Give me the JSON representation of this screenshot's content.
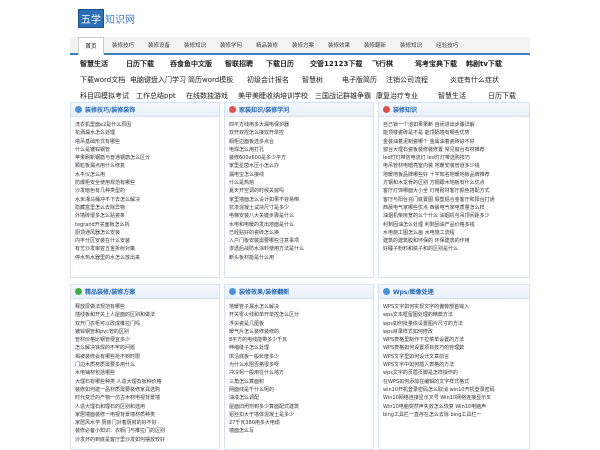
{
  "logo": {
    "box": "五学",
    "rest": "知识网"
  },
  "nav": [
    "首页",
    "装修技巧",
    "装修设备",
    "装修知识",
    "装修学问",
    "精品装修",
    "装修方案",
    "装修效果",
    "装修翻新",
    "装修知识",
    "经验技巧"
  ],
  "links": [
    [
      "智慧生活",
      "日历下载",
      "吞食鱼中文版",
      "智联招聘",
      "下载日历",
      "交管12123下载",
      "飞行棋",
      "驾考宝典下载",
      "韩剧tv下载"
    ],
    [
      "下载word文档",
      "电脑键盘入门学习",
      "简历word模板",
      "初级会计报名",
      "智慧树",
      "电子版简历",
      "注销公司流程",
      "炎症有什么症状"
    ],
    [
      "科目四模拟考试",
      "工作总结ppt",
      "在线数独游戏",
      "美甲美睫收纳培训学校",
      "三国战记群雄争霸",
      "康复治疗专业",
      "智慧生活",
      "日历下载"
    ]
  ],
  "panels": [
    {
      "title": "装修技巧/装修装饰",
      "icon_color": "#4a90d9",
      "items": [
        "洗衣机里面e2是什么原因",
        "花洒漏水怎么处理",
        "塔吊基础形式有哪些",
        "什么是镀锌钢管",
        "苹果刷新钢筋与普通钢筋怎么区分",
        "颗粒板漏点用什么修复",
        "水平仪怎么用",
        "防爆柜安全使用规范有哪些",
        "沙发暗色有几种类型的",
        "水米湘马桶冲不下去怎么解决",
        "隐藏盒里怎么去除异物",
        "外墙砖很多怎么贴瓷条",
        "tegrand开关面板怎么拆",
        "厨顶通风器怎么安装",
        "内丰分区安装在什么安装",
        "有艺沙发审容五金折射对策",
        "停水热水器里的水怎么放出来"
      ]
    },
    {
      "title": "家装知识/装修学问",
      "icon_color": "#e0504e",
      "items": [
        "四平方线用多大漏电保护器",
        "双开双控怎么接双开单控",
        "橱柜边面板选多点合",
        "电焊怎么用打孔",
        "装修600x600是多少平方",
        "家里星茵水压小怎么办",
        "漏电宝怎么接线",
        "什么是热熔",
        "夏天开空调的时候关窗吗",
        "家里墙面怎么设计如果不容易倒",
        "抗渗混凝土试块尺寸是多少",
        "电梯安装八大关键步骤是什么",
        "水电和电暖的发出地面是什么",
        "已经贴好的瓷砖怎么换",
        "入户门板安装需要哪些注意事项",
        "渗透后战防水涂料使用方法是什么",
        "断头板材能是什么用"
      ]
    },
    {
      "title": "装修知识",
      "icon_color": "#e0504e",
      "items": [
        "自己锁一个池如果果断 自闭进出步骤详解",
        "能顶楼瓷砖是不是 能顶隔墙有哪些优势",
        "金装油着泥制瓷哪个 金属油着瓷砖好不好",
        "窗台大理石瓷板装修装修置 常见窗台石材推荐",
        "led灯灯带防电流灯 led灯灯带选购技巧",
        "电吊管材电暗亮室内装 地暖安装管道多少钱",
        "地暖地板品牌哪些好 十字知名地暖地板品牌推荐",
        "方钢和木龙骨的区别 方钢跟木地板有什么优点",
        "客厅灯饰哪面大小全 灯用耐材客厅颜色搭配方式",
        "客厅与阳台充门底置图 假塑铝合金客厅和阳台打通",
        "西晨电气家哪些优点 西晨电气家电质量怎么样",
        "油烟机柴房宽的么个什么 油烟机与吊顶间距多少",
        "利剩固油怎么处理 利剩固油产品价格多钱",
        "水电施工图怎么画 水电施工流程",
        "建筑的建筑胶和环保的 环保建筑的作用",
        "好睡子粉料和腻子和的区别是什么"
      ]
    },
    {
      "title": "精品装修/装修方案",
      "icon_color": "#3fae49",
      "items": [
        "释放层做法规范有哪些",
        "插线板和开关上人屋面的区别和做法",
        "双开门衣柜可以改成推拉门吗",
        "镀锌钢管和pvc管的区别",
        "管材价格比钢管便宜多少",
        "怎么解决铁焊的不牢的问题",
        "褐被装修会有哪些抢不到时限",
        "门边木质材质需要多用什么",
        "水电铺材包括哪些",
        "大理石有哪些种类 人造大理石板种价格",
        "装修如何建一品材质需要装修家具选购",
        "时代变迁的产物一仿古木材电视背景墙",
        "人造大理石和理石的区别和选用",
        "家居墙面装修一电视背景墙材质种类",
        "家居风水学 厨房门对着厨房的好不好",
        "装修必备小知识：衣橱门与推拉门的区别",
        "沙发坏的到底是客厅里沙发如何摆放较好"
      ]
    },
    {
      "title": "装修效果/装修翻新",
      "icon_color": "#4a90d9",
      "items": [
        "地暖管子漏水怎么解决",
        "开关零火线和单开单控怎么区分",
        "浮尖瓷是几厘板",
        "暖气片怎么装修装修的",
        "8平方的电线能带多少千瓦",
        "伸缩缝子怎么处理",
        "床沿底板一般长度多少",
        "为什么水阻否格很多呀",
        "冲冷柯一般用在什么地方",
        "三角怎么算面积",
        "网面线是千什么呢的",
        "油漆怎么调配",
        "屋面旧坍剂到多少算面配式建筑",
        "铝丝扣大于墙体混凝土是多少",
        "27千瓦380用多大电缆",
        "墙面怎么写"
      ]
    },
    {
      "title": "Wps/图像处理",
      "icon_color": "#4a90d9",
      "items": [
        "WPS文字如何实现文字的偏旁部首输入",
        "wps文本框留图处理的精典方法",
        "wps如何批量依设置图片尺寸的方法",
        "wps目录样式如何修改",
        "WPS表格里制作下拉菜单设置的方法",
        "WPS表格如何设置项目技巧的管理数",
        "WPS文字里如何设计文章前言",
        "WPS文字中如何插入表格的方法",
        "wps文字的页眉页脚是怎样操作的",
        "在WPS如何添加在编辑的文字样式格式",
        "win10开机登录密码怎么取消 win10开机登录密码",
        "Win10网络连接显示叉号 Win10网络连接显示叉",
        "Win10电脑突然声失效怎么恢复 Win10电脑声",
        "bing工具栏一直存在怎么去除 bing工具栏一"
      ]
    }
  ]
}
